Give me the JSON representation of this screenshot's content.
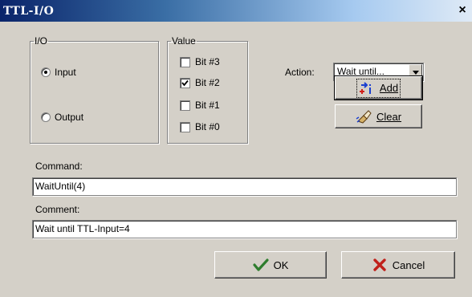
{
  "window": {
    "title": "TTL-I/O",
    "close_glyph": "×"
  },
  "io_group": {
    "legend": "I/O",
    "options": [
      {
        "label": "Input",
        "selected": true
      },
      {
        "label": "Output",
        "selected": false
      }
    ]
  },
  "value_group": {
    "legend": "Value",
    "bits": [
      {
        "label": "Bit #3",
        "checked": false
      },
      {
        "label": "Bit #2",
        "checked": true
      },
      {
        "label": "Bit #1",
        "checked": false
      },
      {
        "label": "Bit #0",
        "checked": false
      }
    ]
  },
  "action": {
    "label": "Action:",
    "value": "Wait until..."
  },
  "buttons": {
    "add": {
      "label": "Add",
      "icon": "add-icon"
    },
    "clear": {
      "label": "Clear",
      "icon": "eraser-icon"
    },
    "ok": {
      "label": "OK",
      "icon": "checkmark-icon",
      "color": "#2e7d2e"
    },
    "cancel": {
      "label": "Cancel",
      "icon": "x-icon",
      "color": "#c0201a"
    }
  },
  "command": {
    "label": "Command:",
    "value": "WaitUntil(4)"
  },
  "comment": {
    "label": "Comment:",
    "value": "Wait until TTL-Input=4"
  }
}
